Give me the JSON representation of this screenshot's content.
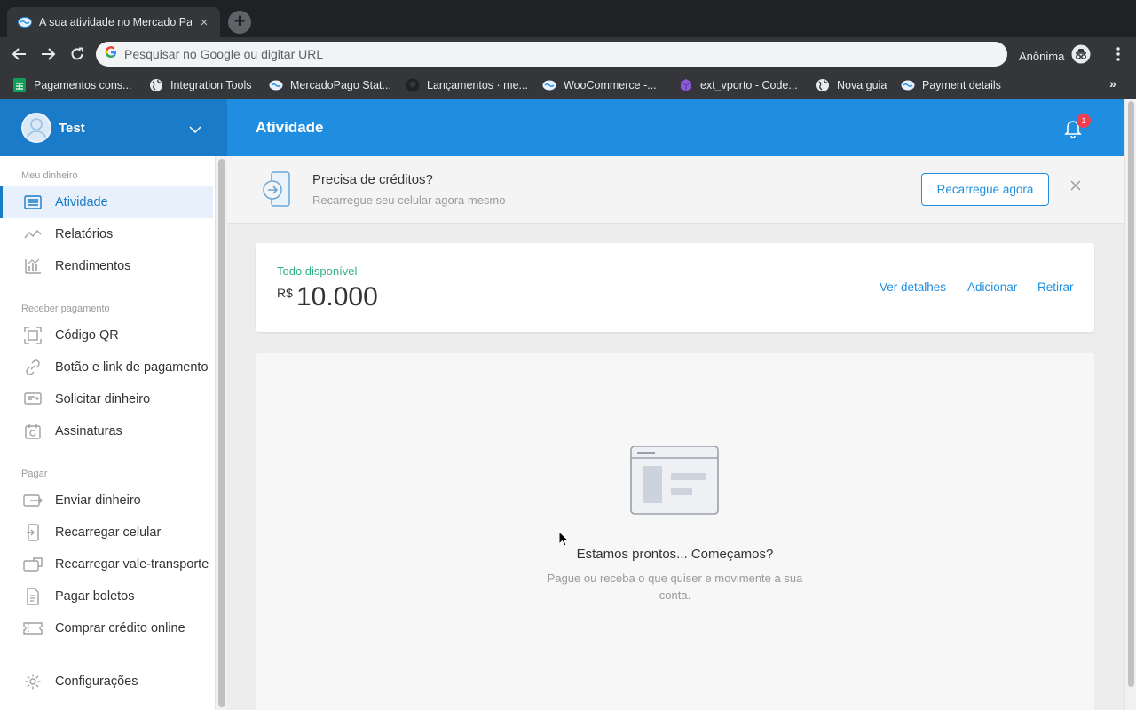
{
  "browser": {
    "tab_title": "A sua atividade no Mercado Pa",
    "tab_close": "×",
    "newtab": "+",
    "omnibox_placeholder": "Pesquisar no Google ou digitar URL",
    "incognito_label": "Anônima",
    "bookmarks": [
      {
        "label": "Pagamentos cons...",
        "icon": "sheets-icon"
      },
      {
        "label": "Integration Tools",
        "icon": "globe-icon"
      },
      {
        "label": "MercadoPago Stat...",
        "icon": "mercadopago-icon"
      },
      {
        "label": "Lançamentos · me...",
        "icon": "github-icon"
      },
      {
        "label": "WooCommerce -...",
        "icon": "mercadopago-icon"
      },
      {
        "label": "ext_vporto - Code...",
        "icon": "cube-icon"
      },
      {
        "label": "Nova guia",
        "icon": "globe-icon"
      },
      {
        "label": "Payment details",
        "icon": "mercadopago-icon"
      }
    ],
    "bookmarks_more": "»"
  },
  "user": {
    "name": "Test"
  },
  "header": {
    "title": "Atividade",
    "notifications_count": "1"
  },
  "sidebar": {
    "sections": [
      {
        "title": "Meu dinheiro",
        "items": [
          {
            "label": "Atividade",
            "icon": "activity-icon",
            "active": true
          },
          {
            "label": "Relatórios",
            "icon": "reports-icon"
          },
          {
            "label": "Rendimentos",
            "icon": "earnings-icon"
          }
        ]
      },
      {
        "title": "Receber pagamento",
        "items": [
          {
            "label": "Código QR",
            "icon": "qr-code-icon"
          },
          {
            "label": "Botão e link de pagamento",
            "icon": "link-icon"
          },
          {
            "label": "Solicitar dinheiro",
            "icon": "request-money-icon"
          },
          {
            "label": "Assinaturas",
            "icon": "subscriptions-icon"
          }
        ]
      },
      {
        "title": "Pagar",
        "items": [
          {
            "label": "Enviar dinheiro",
            "icon": "send-money-icon"
          },
          {
            "label": "Recarregar celular",
            "icon": "phone-recharge-icon"
          },
          {
            "label": "Recarregar vale-transporte",
            "icon": "transport-card-icon"
          },
          {
            "label": "Pagar boletos",
            "icon": "bill-icon"
          },
          {
            "label": "Comprar crédito online",
            "icon": "ticket-icon"
          }
        ]
      }
    ],
    "settings_label": "Configurações"
  },
  "promo": {
    "title": "Precisa de créditos?",
    "subtitle": "Recarregue seu celular agora mesmo",
    "button": "Recarregue agora"
  },
  "balance": {
    "label": "Todo disponível",
    "currency": "R$",
    "amount": "10.000",
    "links": [
      "Ver detalhes",
      "Adicionar",
      "Retirar"
    ]
  },
  "empty_state": {
    "title": "Estamos prontos... Começamos?",
    "subtitle": "Pague ou receba o que quiser e movimente a sua conta."
  },
  "colors": {
    "brand_blue": "#1f8ee0",
    "sidebar_header": "#1a7cc8",
    "accent_green": "#2fb08a",
    "badge_red": "#f23d4f"
  }
}
